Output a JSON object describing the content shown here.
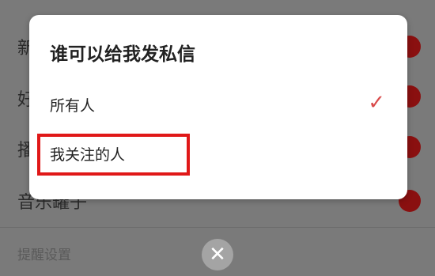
{
  "background": {
    "rows": [
      {
        "label": "新"
      },
      {
        "label": "好"
      },
      {
        "label": "播"
      },
      {
        "label": "音乐罐子"
      }
    ],
    "footer_label": "提醒设置"
  },
  "dialog": {
    "title": "谁可以给我发私信",
    "options": [
      {
        "label": "所有人",
        "selected": true,
        "check_icon": "✓"
      },
      {
        "label": "我关注的人",
        "selected": false
      }
    ]
  },
  "highlight_color": "#e01818",
  "accent_color": "#d94b4b",
  "close_button": {
    "icon": "close-icon",
    "glyph": "✕"
  }
}
